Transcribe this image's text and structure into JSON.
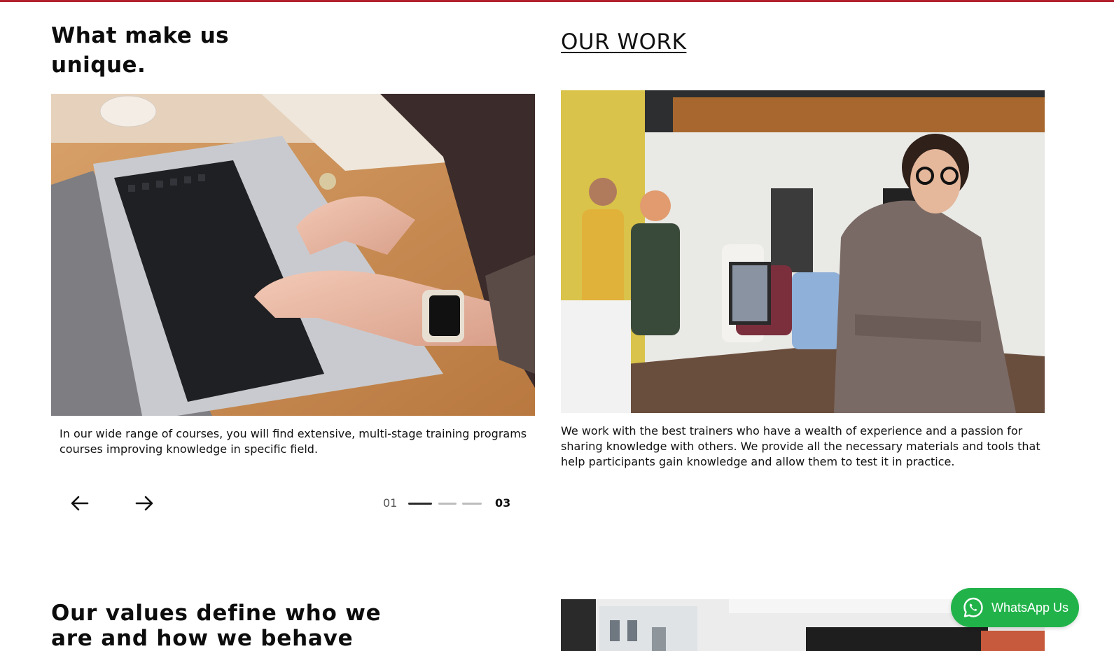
{
  "unique_section": {
    "heading": "What make us unique.",
    "caption": "In our wide range of courses, you will find extensive, multi-stage training programs courses improving knowledge in specific field.",
    "slider": {
      "current": "01",
      "total": "03"
    },
    "photo_icon": "laptop-typing-photo"
  },
  "work_section": {
    "heading": "OUR WORK",
    "caption": "We work with the best trainers who have a wealth of experience and a passion for sharing knowledge with others. We provide all the necessary materials and tools that help participants gain knowledge and allow them to test it in practice.",
    "photo_icon": "team-office-photo"
  },
  "values_section": {
    "heading": "Our values define who we are and how we behave",
    "photo_icon": "office-interior-photo"
  },
  "whatsapp": {
    "label": "WhatsApp Us",
    "color": "#21b34a"
  },
  "accent_color": "#b3202e"
}
